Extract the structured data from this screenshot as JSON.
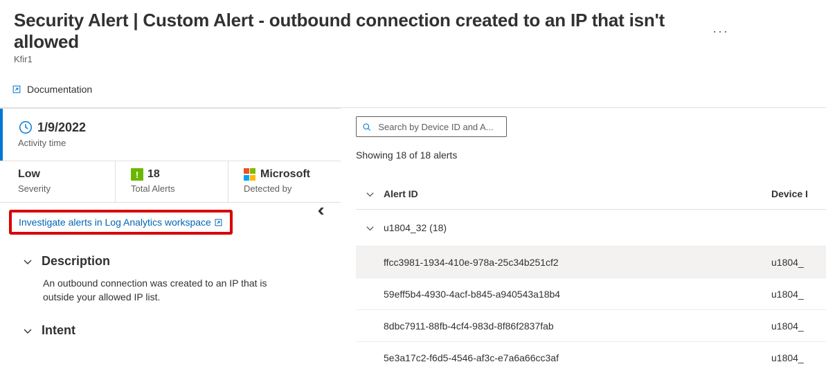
{
  "header": {
    "title": "Security Alert | Custom Alert - outbound connection created to an IP that isn't allowed",
    "subtitle": "Kfir1",
    "more_glyph": "···"
  },
  "doc_link": {
    "label": "Documentation"
  },
  "collapse_glyph": "‹‹",
  "card": {
    "date": "1/9/2022",
    "activity_label": "Activity time",
    "severity": {
      "value": "Low",
      "label": "Severity"
    },
    "total_alerts": {
      "value": "18",
      "label": "Total Alerts",
      "badge_glyph": "!"
    },
    "detected_by": {
      "value": "Microsoft",
      "label": "Detected by"
    }
  },
  "investigate": {
    "label": "Investigate alerts in Log Analytics workspace"
  },
  "sections": {
    "description": {
      "title": "Description",
      "body": "An outbound connection was created to an IP that is outside your allowed IP list."
    },
    "intent": {
      "title": "Intent"
    }
  },
  "search": {
    "placeholder": "Search by Device ID and A..."
  },
  "results": {
    "summary": "Showing 18 of 18 alerts"
  },
  "table": {
    "columns": {
      "alert_id": "Alert ID",
      "device": "Device I"
    },
    "group": {
      "label": "u1804_32 (18)"
    },
    "rows": [
      {
        "alert_id": "ffcc3981-1934-410e-978a-25c34b251cf2",
        "device": "u1804_",
        "selected": true
      },
      {
        "alert_id": "59eff5b4-4930-4acf-b845-a940543a18b4",
        "device": "u1804_",
        "selected": false
      },
      {
        "alert_id": "8dbc7911-88fb-4cf4-983d-8f86f2837fab",
        "device": "u1804_",
        "selected": false
      },
      {
        "alert_id": "5e3a17c2-f6d5-4546-af3c-e7a6a66cc3af",
        "device": "u1804_",
        "selected": false
      }
    ]
  },
  "colors": {
    "link": "#0065b3",
    "accent": "#0078d4",
    "highlight_border": "#d90000",
    "ms_logo": [
      "#f25022",
      "#7fba00",
      "#00a4ef",
      "#ffb900"
    ],
    "badge_green": "#6bb700"
  }
}
